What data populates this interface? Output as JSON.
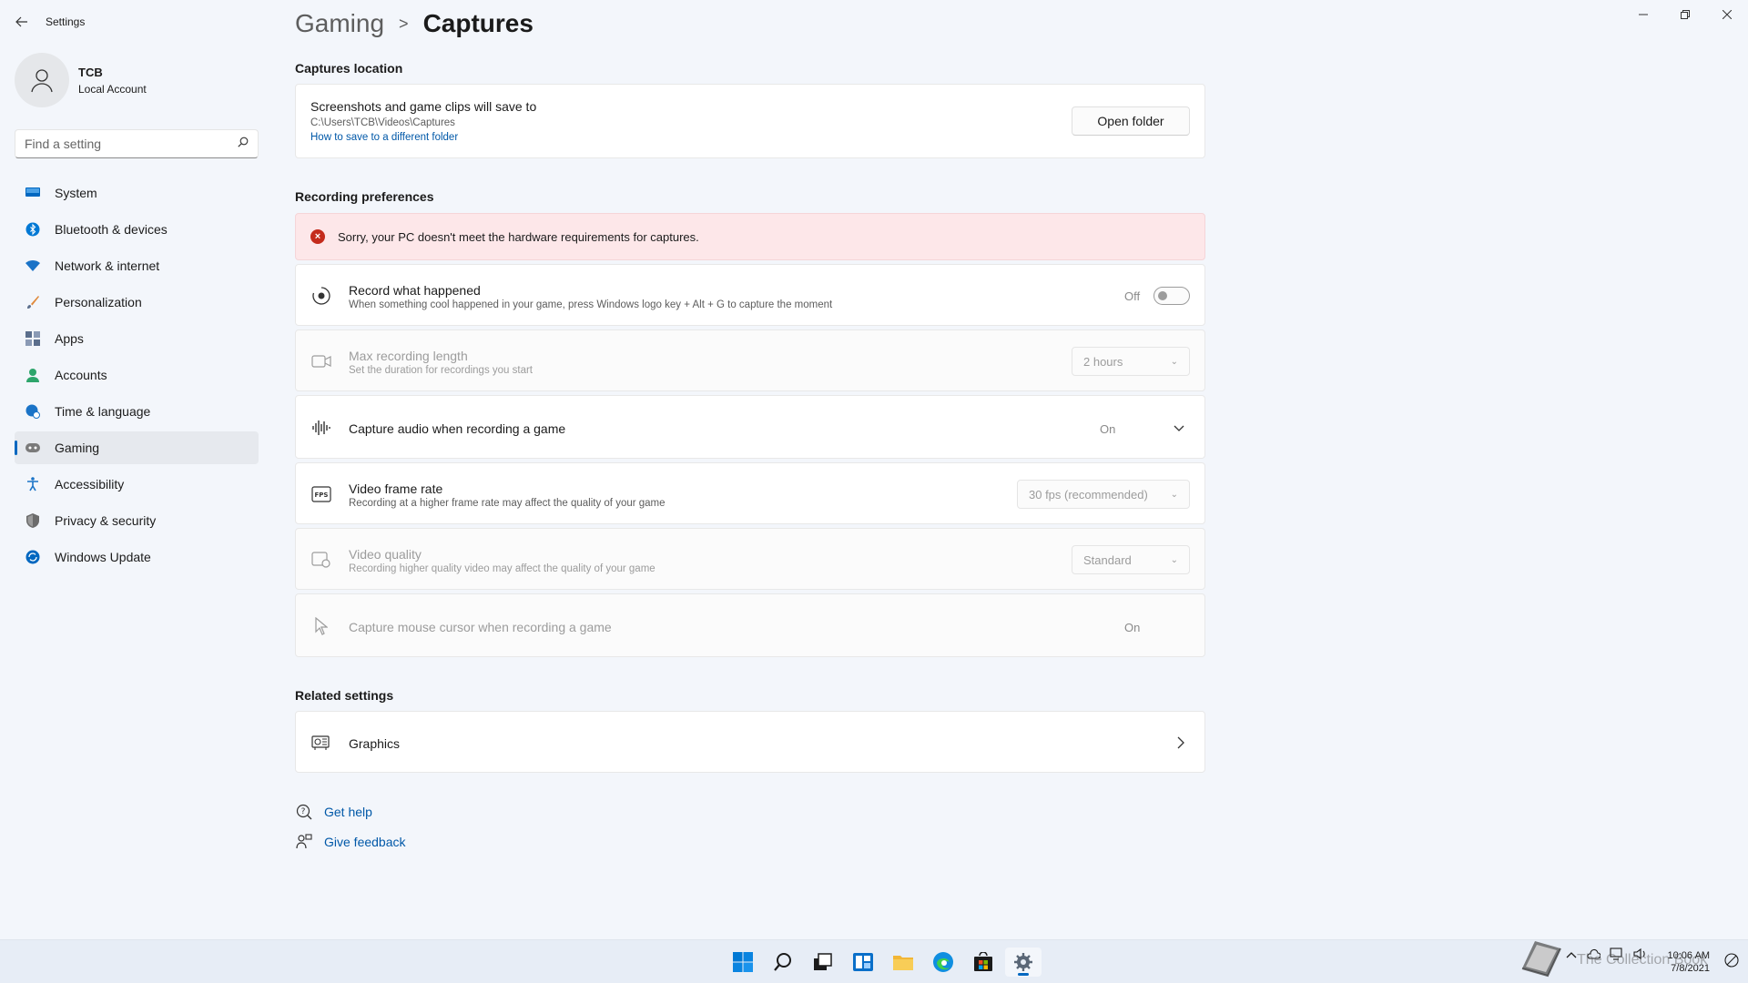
{
  "window": {
    "app_title": "Settings",
    "back_icon": "back-arrow-icon",
    "minimize_icon": "minimize-icon",
    "restore_icon": "restore-icon",
    "close_icon": "close-icon"
  },
  "profile": {
    "name": "TCB",
    "account_type": "Local Account"
  },
  "search": {
    "placeholder": "Find a setting"
  },
  "sidebar": {
    "items": [
      {
        "label": "System",
        "icon": "monitor-icon",
        "color": "#0067c0"
      },
      {
        "label": "Bluetooth & devices",
        "icon": "bluetooth-icon",
        "color": "#0078d4"
      },
      {
        "label": "Network & internet",
        "icon": "wifi-icon",
        "color": "#1a73c7"
      },
      {
        "label": "Personalization",
        "icon": "brush-icon",
        "color": "#e08a3c"
      },
      {
        "label": "Apps",
        "icon": "apps-icon",
        "color": "#5b6e8c"
      },
      {
        "label": "Accounts",
        "icon": "person-icon",
        "color": "#2da56b"
      },
      {
        "label": "Time & language",
        "icon": "globe-clock-icon",
        "color": "#1a73c7"
      },
      {
        "label": "Gaming",
        "icon": "gamepad-icon",
        "color": "#7a7a7a"
      },
      {
        "label": "Accessibility",
        "icon": "accessibility-icon",
        "color": "#1a73c7"
      },
      {
        "label": "Privacy & security",
        "icon": "shield-icon",
        "color": "#6b6b6b"
      },
      {
        "label": "Windows Update",
        "icon": "update-icon",
        "color": "#0067c0"
      }
    ],
    "active_index": 7
  },
  "breadcrumb": {
    "parent": "Gaming",
    "separator": ">",
    "current": "Captures"
  },
  "captures_location": {
    "section_title": "Captures location",
    "title": "Screenshots and game clips will save to",
    "path": "C:\\Users\\TCB\\Videos\\Captures",
    "link": "How to save to a different folder",
    "button": "Open folder"
  },
  "recording": {
    "section_title": "Recording preferences",
    "error": "Sorry, your PC doesn't meet the hardware requirements for captures.",
    "record_what_happened": {
      "title": "Record what happened",
      "subtitle": "When something cool happened in your game, press Windows logo key + Alt + G to capture the moment",
      "state": "Off"
    },
    "max_length": {
      "title": "Max recording length",
      "subtitle": "Set the duration for recordings you start",
      "value": "2 hours"
    },
    "capture_audio": {
      "title": "Capture audio when recording a game",
      "state": "On"
    },
    "frame_rate": {
      "title": "Video frame rate",
      "subtitle": "Recording at a higher frame rate may affect the quality of your game",
      "value": "30 fps (recommended)"
    },
    "video_quality": {
      "title": "Video quality",
      "subtitle": "Recording higher quality video may affect the quality of your game",
      "value": "Standard"
    },
    "mouse_cursor": {
      "title": "Capture mouse cursor when recording a game",
      "state": "On"
    }
  },
  "related": {
    "section_title": "Related settings",
    "graphics": "Graphics"
  },
  "help": {
    "get_help": "Get help",
    "give_feedback": "Give feedback"
  },
  "taskbar": {
    "apps": [
      "start-icon",
      "search-icon",
      "task-view-icon",
      "widgets-icon",
      "file-explorer-icon",
      "edge-icon",
      "store-icon",
      "settings-icon"
    ],
    "time": "10:06 AM",
    "date": "7/8/2021",
    "watermark": "The Collection Book"
  },
  "colors": {
    "accent": "#0067c0",
    "error_bg": "#fde7e9",
    "error_icon": "#c42b1c",
    "link": "#0058a8"
  }
}
